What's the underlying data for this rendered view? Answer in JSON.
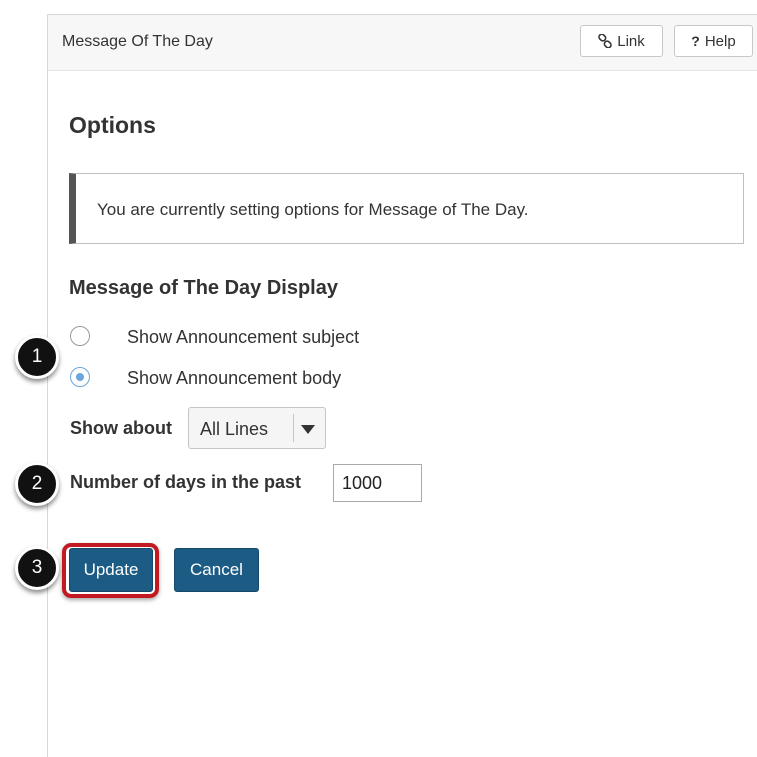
{
  "panel": {
    "title": "Message Of The Day",
    "link_button": "Link",
    "help_button_icon_text": "?",
    "help_button": "Help"
  },
  "options": {
    "heading": "Options",
    "info": "You are currently setting options for Message of The Day.",
    "display_heading": "Message of The Day Display",
    "radio_subject": "Show Announcement subject",
    "radio_body": "Show Announcement body",
    "selected_radio": "Show Announcement body",
    "show_about_label": "Show about",
    "show_about_value": "All Lines",
    "days_label": "Number of days in the past",
    "days_value": "1000"
  },
  "actions": {
    "update": "Update",
    "cancel": "Cancel"
  },
  "callouts": {
    "step1": "1",
    "step2": "2",
    "step3": "3",
    "highlight_color": "#c21a22"
  },
  "icons": {
    "link": "link-icon",
    "select_arrow": "caret-down-icon"
  }
}
